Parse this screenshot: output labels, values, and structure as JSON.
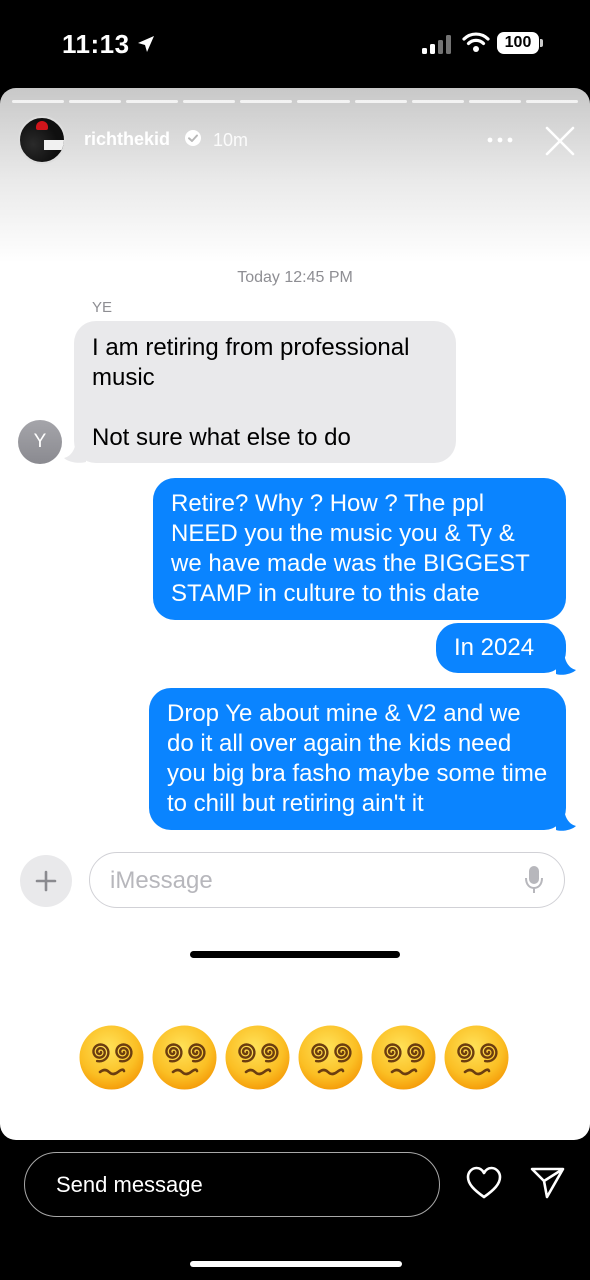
{
  "status_bar": {
    "time": "11:13",
    "battery": "100"
  },
  "story": {
    "username": "richthekid",
    "time_ago": "10m",
    "progress_segments": 10
  },
  "chat": {
    "timestamp": "Today 12:45 PM",
    "sender_name": "YE",
    "contact_initial": "Y",
    "messages": [
      {
        "direction": "incoming",
        "text": "I am retiring from professional music\n\nNot sure what else to do"
      },
      {
        "direction": "outgoing",
        "text": "Retire? Why ? How ? The ppl NEED you the music you & Ty & we have made was the BIGGEST STAMP in culture to this date"
      },
      {
        "direction": "outgoing",
        "text": "In 2024"
      },
      {
        "direction": "outgoing",
        "text": "Drop Ye about mine & V2 and we do it all over again the kids need you big bra fasho maybe some time to chill but retiring ain't it"
      }
    ],
    "input_placeholder": "iMessage"
  },
  "emoji_reactions": {
    "icon": "dizzy-face-emoji",
    "count": 6
  },
  "bottom_bar": {
    "send_placeholder": "Send message"
  },
  "colors": {
    "outgoing_bubble": "#0a84ff",
    "incoming_bubble": "#e9e9eb",
    "background": "#000000"
  }
}
